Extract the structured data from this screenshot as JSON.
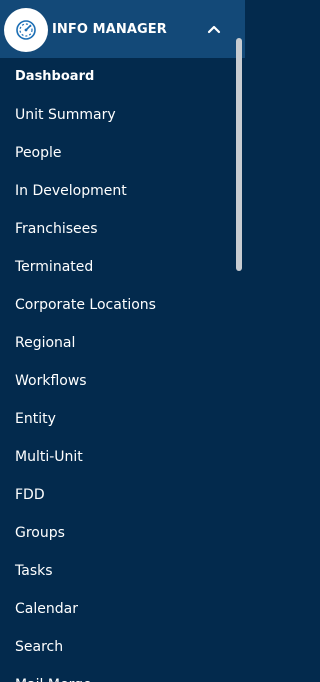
{
  "header": {
    "title": "INFO MANAGER",
    "logo_icon": "gauge-icon",
    "collapse_icon": "chevron-up-icon"
  },
  "menu": {
    "items": [
      {
        "label": "Dashboard",
        "active": true
      },
      {
        "label": "Unit Summary"
      },
      {
        "label": "People"
      },
      {
        "label": "In Development"
      },
      {
        "label": "Franchisees"
      },
      {
        "label": "Terminated"
      },
      {
        "label": "Corporate Locations"
      },
      {
        "label": "Regional"
      },
      {
        "label": "Workflows"
      },
      {
        "label": "Entity"
      },
      {
        "label": "Multi-Unit"
      },
      {
        "label": "FDD"
      },
      {
        "label": "Groups"
      },
      {
        "label": "Tasks"
      },
      {
        "label": "Calendar"
      },
      {
        "label": "Search"
      },
      {
        "label": "Mail Merge"
      }
    ]
  },
  "colors": {
    "background": "#032a4d",
    "header": "#134978",
    "logo_ring": "#1c6fb5",
    "scrollbar": "#c8ccd1"
  }
}
